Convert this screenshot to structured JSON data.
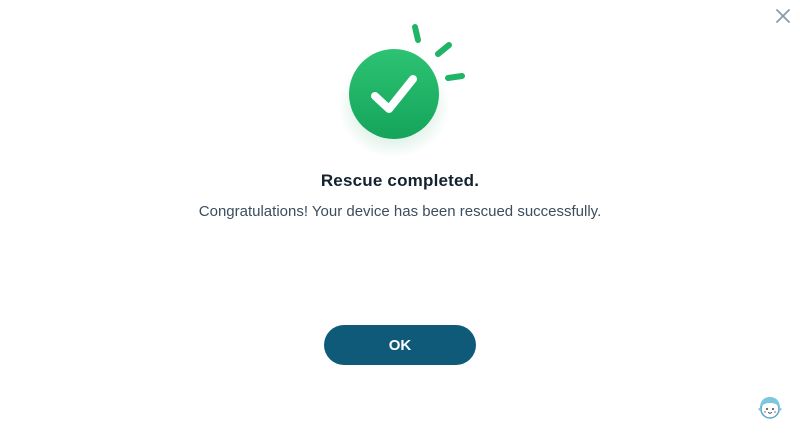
{
  "dialog": {
    "title": "Rescue completed.",
    "message": "Congratulations! Your device has been rescued successfully.",
    "ok_label": "OK"
  },
  "icons": {
    "close": "close-icon",
    "success": "checkmark-icon",
    "mascot": "assistant-mascot-icon"
  },
  "colors": {
    "success_green": "#20b466",
    "button": "#0e5a78",
    "title": "#14222f",
    "text": "#3c4e5e",
    "close": "#8c9aa6"
  }
}
